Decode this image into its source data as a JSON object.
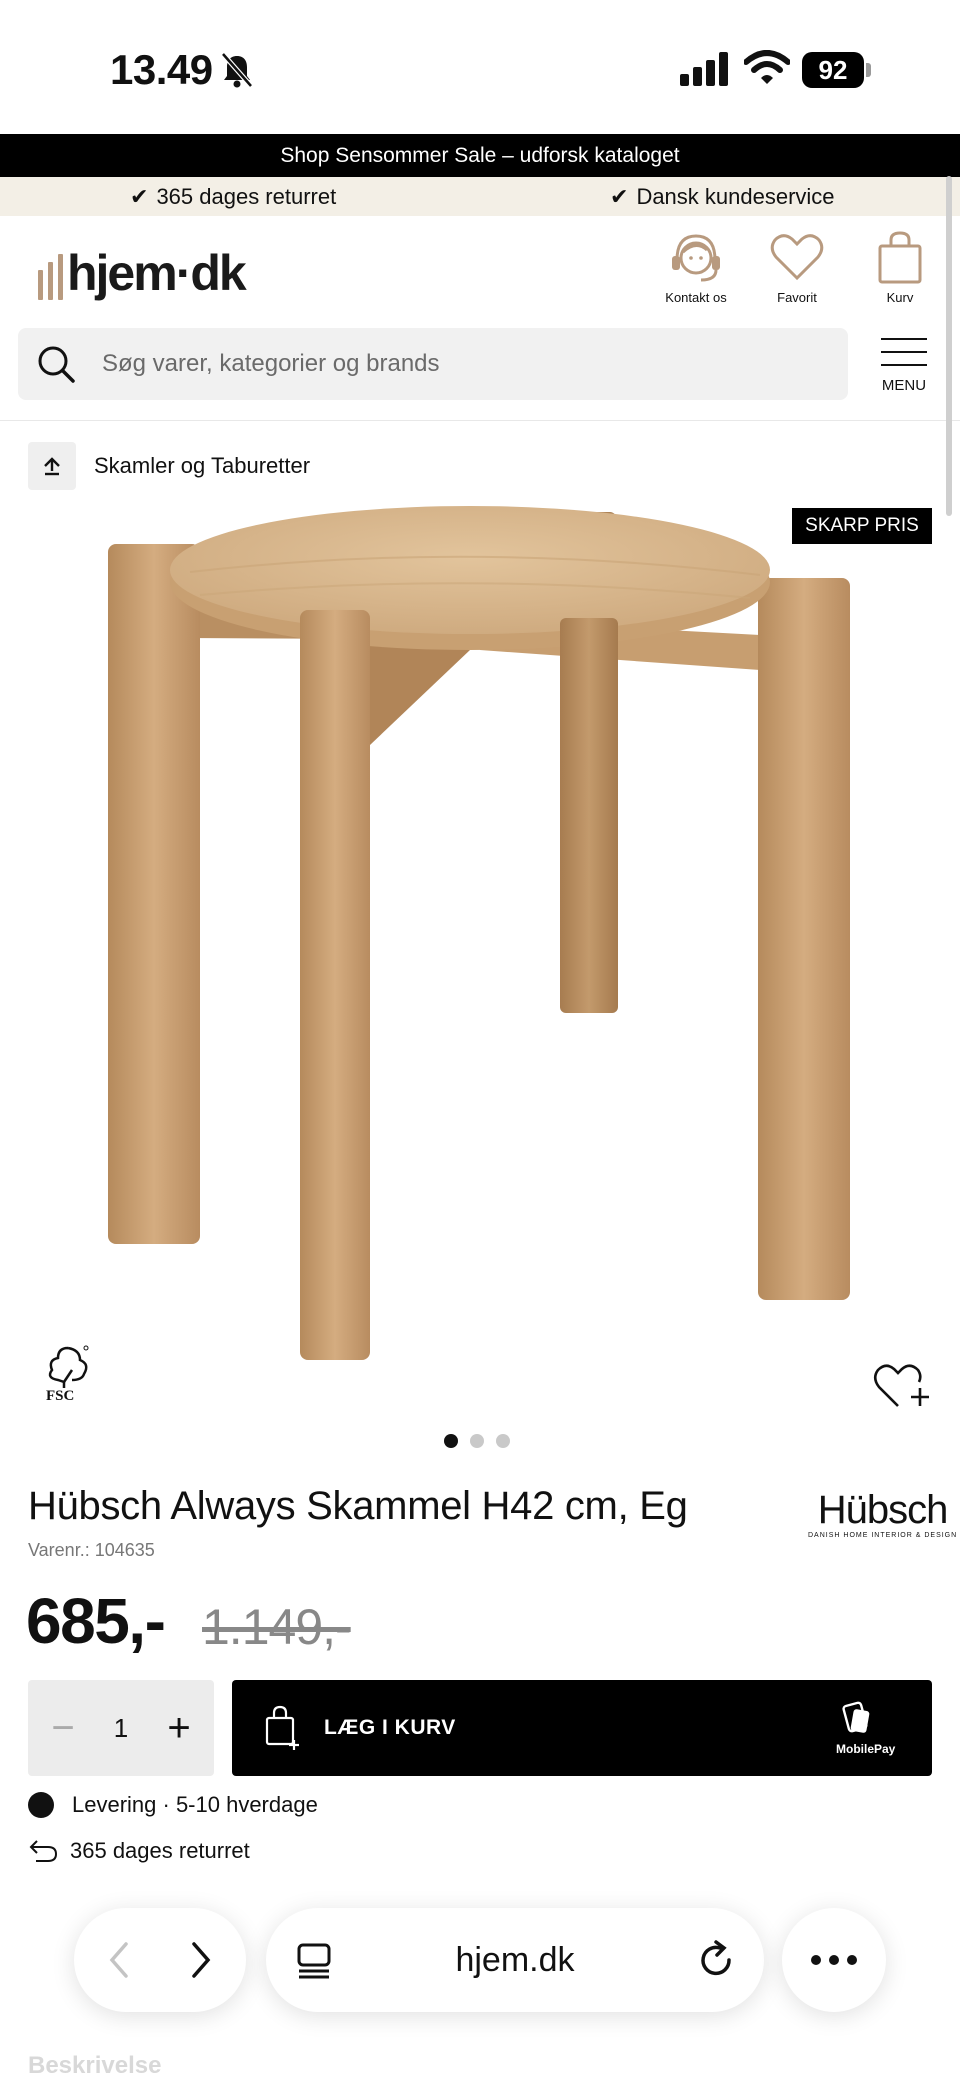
{
  "status_bar": {
    "time": "13.49",
    "battery": "92"
  },
  "promo_banner": "Shop Sensommer Sale – udforsk kataloget",
  "usps": [
    "365 dages returret",
    "Dansk kundeservice"
  ],
  "header": {
    "logo": "hjem·dk",
    "actions": [
      {
        "label": "Kontakt os",
        "icon": "headset-icon"
      },
      {
        "label": "Favorit",
        "icon": "heart-icon"
      },
      {
        "label": "Kurv",
        "icon": "shopping-bag-icon"
      }
    ],
    "menu_label": "MENU"
  },
  "search": {
    "placeholder": "Søg varer, kategorier og brands"
  },
  "breadcrumb": {
    "label": "Skamler og Taburetter"
  },
  "product": {
    "badge": "SKARP PRIS",
    "fsc_label": "FSC",
    "image_dots": 3,
    "active_dot": 0,
    "title": "Hübsch Always Skammel H42 cm, Eg",
    "sku": "Varenr.: 104635",
    "brand": {
      "name": "Hübsch",
      "tagline": "DANISH HOME INTERIOR & DESIGN"
    },
    "price": "685,-",
    "old_price": "1.149,-",
    "quantity": "1",
    "qty_minus": "−",
    "qty_plus": "+",
    "add_to_cart": "LÆG I KURV",
    "payment_label": "MobilePay",
    "delivery": "Levering · 5-10 hverdage",
    "returns": "365 dages returret"
  },
  "browser": {
    "url": "hjem.dk"
  },
  "faded_section": "Beskrivelse",
  "colors": {
    "black": "#000000",
    "usp_bg": "#f3efe6",
    "logo_accent": "#b89a7f",
    "wood": "#c9a27a"
  }
}
